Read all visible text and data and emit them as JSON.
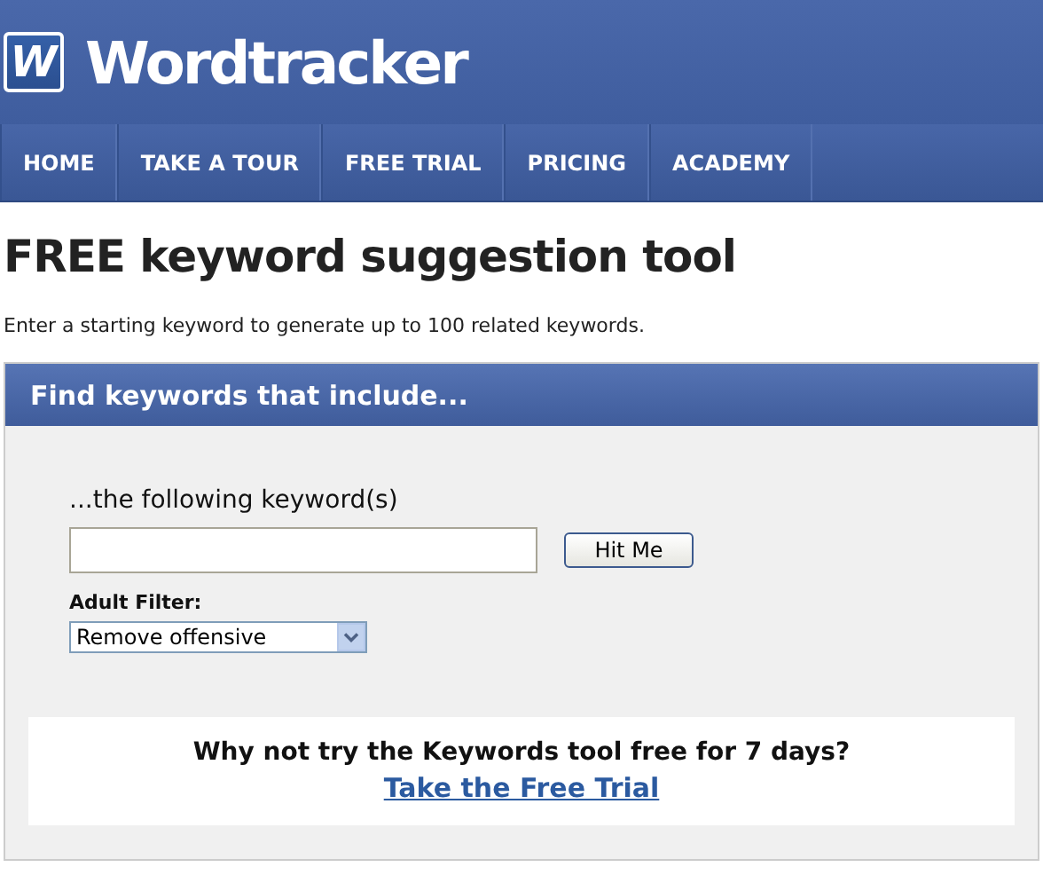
{
  "header": {
    "logo_mark": "W",
    "logo_text": "Wordtracker"
  },
  "nav": [
    {
      "label": "HOME"
    },
    {
      "label": "TAKE A TOUR"
    },
    {
      "label": "FREE TRIAL"
    },
    {
      "label": "PRICING"
    },
    {
      "label": "ACADEMY"
    }
  ],
  "title": "FREE keyword suggestion tool",
  "intro": "Enter a starting keyword to generate up to 100 related keywords.",
  "panel": {
    "heading": "Find keywords that include...",
    "keyword_label": "...the following keyword(s)",
    "submit": "Hit Me",
    "filter_label": "Adult Filter:",
    "filter_value": "Remove offensive"
  },
  "promo": {
    "question": "Why not try the Keywords tool free for 7 days?",
    "link": "Take the Free Trial"
  }
}
